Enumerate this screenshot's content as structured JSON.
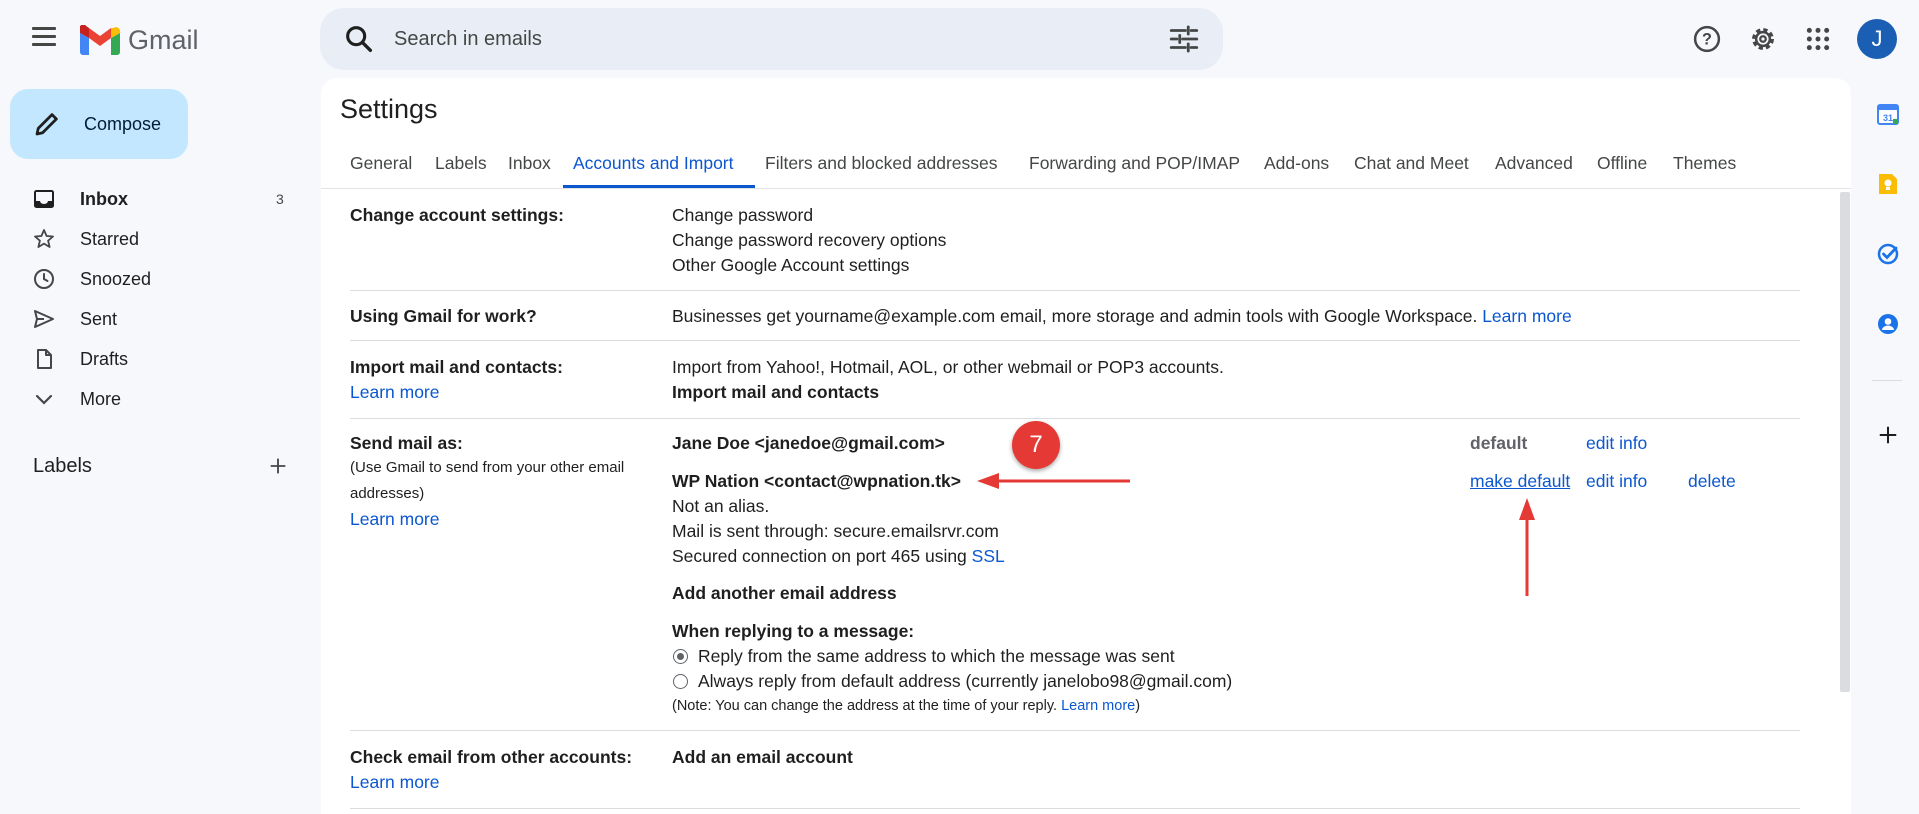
{
  "header": {
    "app_name": "Gmail",
    "search_placeholder": "Search in emails",
    "avatar_letter": "J"
  },
  "icons": {
    "menu": "menu-icon",
    "search": "search-icon",
    "tune": "tune-icon",
    "help": "help-icon",
    "settings": "gear-icon",
    "apps": "apps-grid-icon"
  },
  "sidebar": {
    "compose_label": "Compose",
    "items": [
      {
        "label": "Inbox",
        "count": "3",
        "icon": "inbox-icon"
      },
      {
        "label": "Starred",
        "count": "",
        "icon": "star-icon"
      },
      {
        "label": "Snoozed",
        "count": "",
        "icon": "clock-icon"
      },
      {
        "label": "Sent",
        "count": "",
        "icon": "send-icon"
      },
      {
        "label": "Drafts",
        "count": "",
        "icon": "draft-icon"
      },
      {
        "label": "More",
        "count": "",
        "icon": "chevron-down-icon"
      }
    ],
    "labels_heading": "Labels"
  },
  "settings": {
    "title": "Settings",
    "tabs": [
      {
        "label": "General"
      },
      {
        "label": "Labels"
      },
      {
        "label": "Inbox"
      },
      {
        "label": "Accounts and Import"
      },
      {
        "label": "Filters and blocked addresses"
      },
      {
        "label": "Forwarding and POP/IMAP"
      },
      {
        "label": "Add-ons"
      },
      {
        "label": "Chat and Meet"
      },
      {
        "label": "Advanced"
      },
      {
        "label": "Offline"
      },
      {
        "label": "Themes"
      }
    ],
    "active_tab": "Accounts and Import",
    "change_account": {
      "label": "Change account settings:",
      "links": [
        "Change password",
        "Change password recovery options",
        "Other Google Account settings"
      ]
    },
    "work": {
      "label": "Using Gmail for work?",
      "text": "Businesses get yourname@example.com email, more storage and admin tools with Google Workspace.",
      "link": "Learn more"
    },
    "import": {
      "label": "Import mail and contacts:",
      "learn_more": "Learn more",
      "text": "Import from Yahoo!, Hotmail, AOL, or other webmail or POP3 accounts.",
      "action": "Import mail and contacts"
    },
    "send_as": {
      "label": "Send mail as:",
      "note_line1": "(Use Gmail to send from your other email",
      "note_line2": "addresses)",
      "learn_more": "Learn more",
      "primary": {
        "address": "Jane Doe <janedoe@gmail.com>",
        "status": "default",
        "edit": "edit info"
      },
      "secondary": {
        "address": "WP Nation <contact@wpnation.tk>",
        "alias_text": "Not an alias.",
        "server_text": "Mail is sent through: secure.emailsrvr.com",
        "ssl_prefix": "Secured connection on port 465 using",
        "ssl_link": "SSL",
        "make_default": "make default",
        "edit": "edit info",
        "delete": "delete"
      },
      "add_address": "Add another email address",
      "reply_heading": "When replying to a message:",
      "reply_same": "Reply from the same address to which the message was sent",
      "reply_default": "Always reply from default address (currently janelobo98@gmail.com)",
      "reply_note": "(Note: You can change the address at the time of your reply.",
      "reply_note_link": "Learn more",
      "reply_note_end": ")"
    },
    "check_email": {
      "label": "Check email from other accounts:",
      "learn_more": "Learn more",
      "action": "Add an email account"
    }
  },
  "annotation": {
    "step_number": "7",
    "color": "#e53935"
  },
  "right_rail": [
    "calendar-icon",
    "keep-icon",
    "tasks-icon",
    "contacts-icon",
    "add-icon"
  ]
}
